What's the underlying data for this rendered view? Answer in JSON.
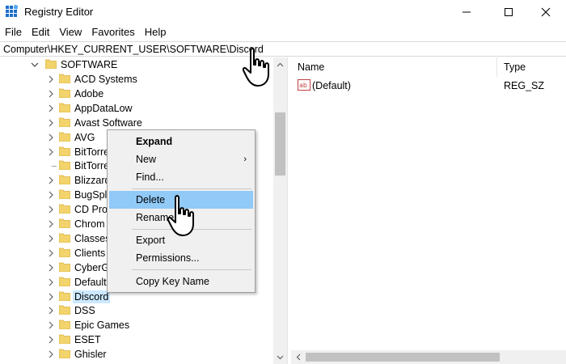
{
  "window": {
    "title": "Registry Editor",
    "controls": {
      "minimize": "minimize",
      "maximize": "maximize",
      "close": "close"
    }
  },
  "menubar": {
    "items": [
      "File",
      "Edit",
      "View",
      "Favorites",
      "Help"
    ]
  },
  "address": {
    "path": "Computer\\HKEY_CURRENT_USER\\SOFTWARE\\Discord"
  },
  "tree": {
    "parent": "SOFTWARE",
    "children": [
      "ACD Systems",
      "Adobe",
      "AppDataLow",
      "Avast Software",
      "AVG",
      "BitTorre",
      "BitTorre",
      "Blizzard",
      "BugSpl",
      "CD Pro",
      "Chrom",
      "Classes",
      "Clients",
      "CyberG",
      "Default",
      "Discord",
      "DSS",
      "Epic Games",
      "ESET",
      "Ghisler"
    ],
    "selected_index": 15
  },
  "right_pane": {
    "columns": [
      "Name",
      "Type"
    ],
    "values": [
      {
        "icon": "string-value-icon",
        "name": "(Default)",
        "type": "REG_SZ"
      }
    ]
  },
  "context_menu": {
    "items": [
      {
        "label": "Expand",
        "bold": true
      },
      {
        "label": "New",
        "submenu": true
      },
      {
        "label": "Find..."
      },
      {
        "separator": true
      },
      {
        "label": "Delete",
        "highlight": true
      },
      {
        "label": "Rename"
      },
      {
        "separator": true
      },
      {
        "label": "Export"
      },
      {
        "label": "Permissions..."
      },
      {
        "separator": true
      },
      {
        "label": "Copy Key Name"
      }
    ],
    "submenu_glyph": "›"
  },
  "colors": {
    "folder": "#f3d36b",
    "folder_dark": "#d9b03f",
    "selection": "#cce8ff",
    "menu_highlight": "#91c9f7",
    "menu_bg": "#f0f0f0"
  }
}
